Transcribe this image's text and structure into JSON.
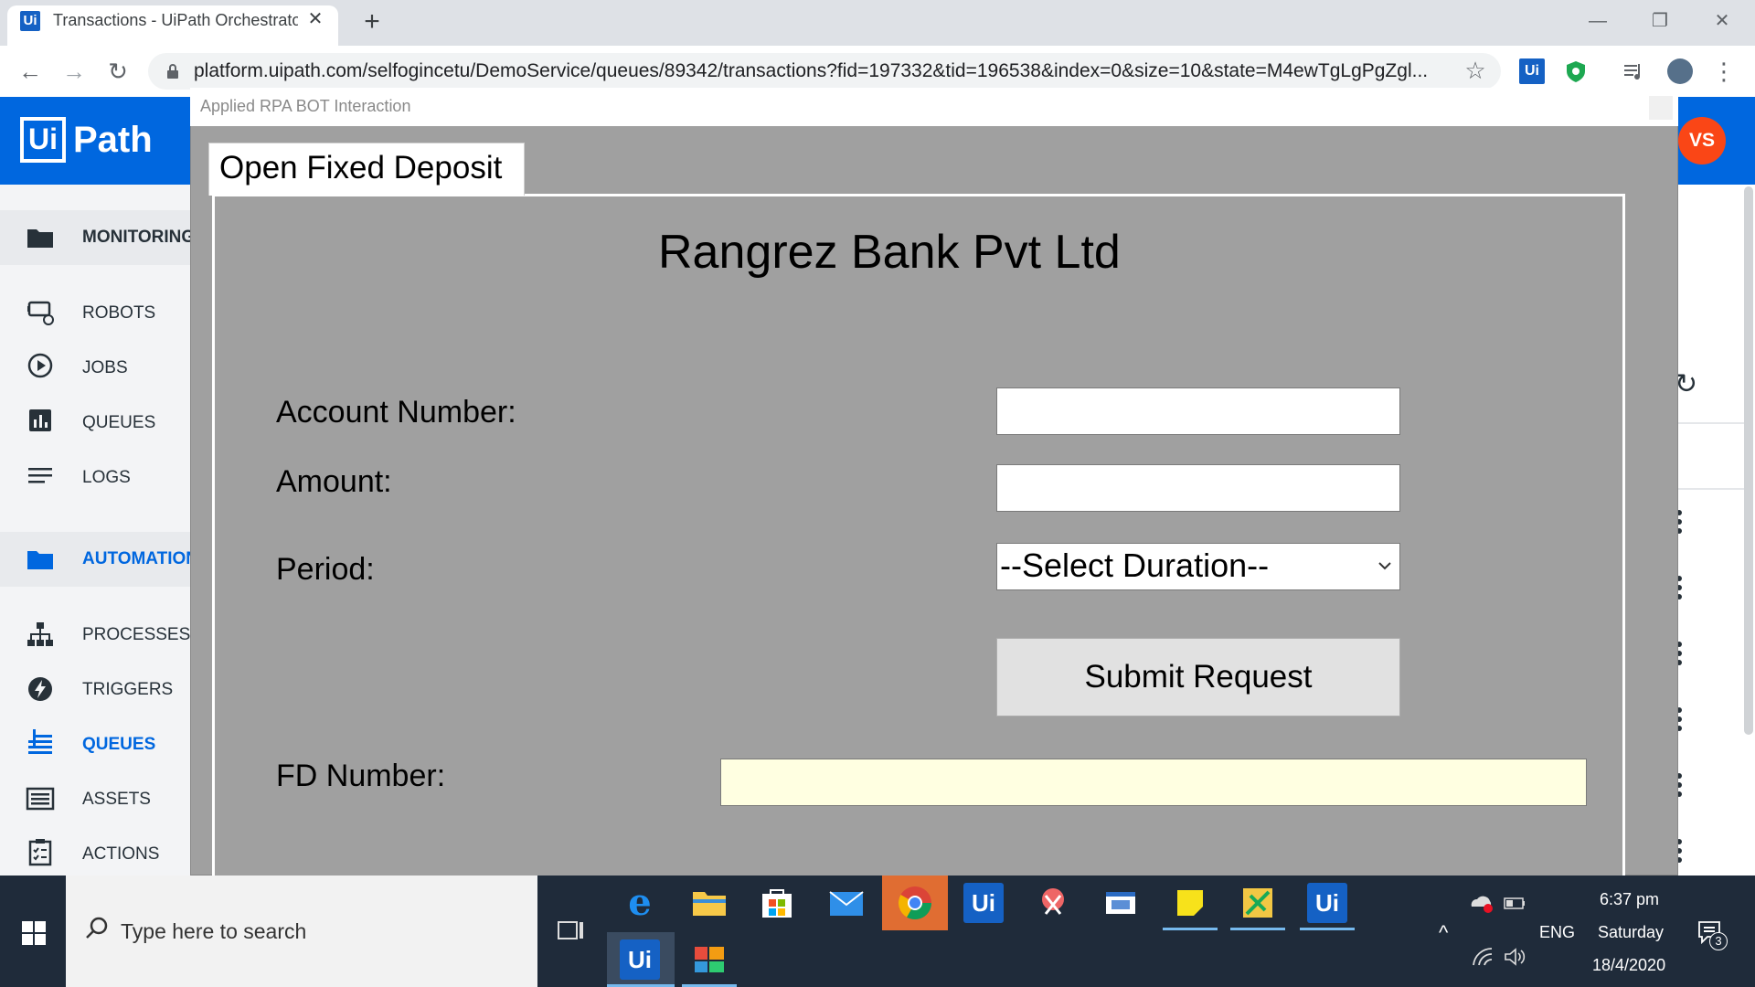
{
  "browser": {
    "tab_title": "Transactions - UiPath Orchestrator",
    "tab_favicon_text": "Ui",
    "url": "platform.uipath.com/selfogincetu/DemoService/queues/89342/transactions?fid=197332&tid=196538&index=0&size=10&state=M4ewTgLgPgZgl...",
    "ext_ui_text": "Ui"
  },
  "orchestrator": {
    "logo_box": "Ui",
    "logo_text": "Path",
    "avatar": "VS",
    "sidebar": {
      "monitoring": "MONITORING",
      "robots": "ROBOTS",
      "jobs": "JOBS",
      "queues_monitor": "QUEUES",
      "logs": "LOGS",
      "automations": "AUTOMATIONS",
      "processes": "PROCESSES",
      "triggers": "TRIGGERS",
      "queues": "QUEUES",
      "assets": "ASSETS",
      "actions": "ACTIONS"
    }
  },
  "dialog": {
    "title": "Applied RPA BOT Interaction",
    "tab_label": "Open Fixed Deposit",
    "bank_name": "Rangrez Bank Pvt Ltd",
    "account_label": "Account Number:",
    "account_value": "",
    "amount_label": "Amount:",
    "amount_value": "",
    "period_label": "Period:",
    "period_selected": "--Select Duration--",
    "submit_label": "Submit Request",
    "fd_label": "FD Number:",
    "fd_value": ""
  },
  "taskbar": {
    "search_placeholder": "Type here to search",
    "uipath_label": "Ui",
    "time": "6:37 pm",
    "day": "Saturday",
    "date": "18/4/2020",
    "language": "ENG",
    "notification_count": "3"
  },
  "colors": {
    "header_blue": "#0067df",
    "avatar_orange": "#fa4616",
    "dialog_gray": "#a0a0a0",
    "fd_field": "#ffffe1",
    "active_nav": "#0067df"
  }
}
